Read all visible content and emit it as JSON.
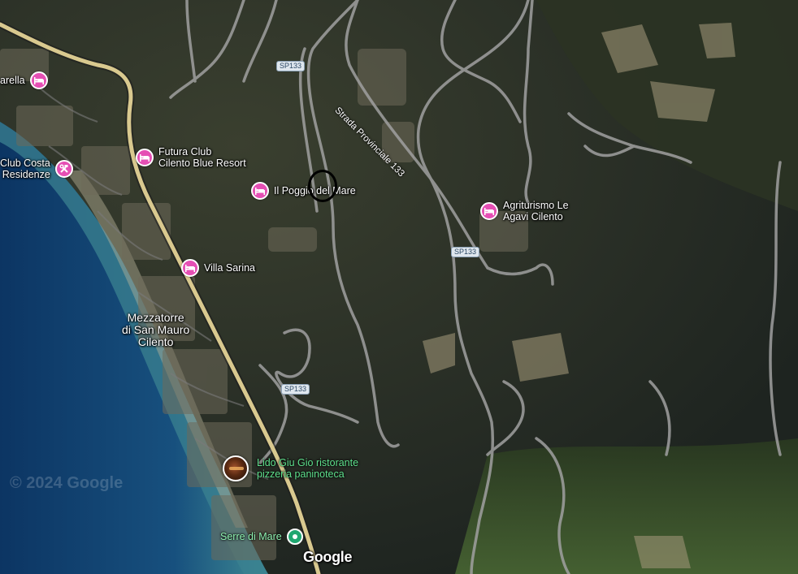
{
  "map": {
    "type": "satellite",
    "attribution": "Google",
    "copyright": "© 2024 Google"
  },
  "places": {
    "arella": {
      "name": "arella",
      "icon": "hotel-icon"
    },
    "club_costa": {
      "line1": "Club Costa",
      "line2": "Residenze",
      "icon": "tools-icon"
    },
    "futura": {
      "line1": "Futura Club",
      "line2": "Cilento Blue Resort",
      "icon": "hotel-icon"
    },
    "poggio": {
      "name": "Il Poggio del Mare",
      "icon": "hotel-icon"
    },
    "agriturismo": {
      "line1": "Agriturismo Le",
      "line2": "Agavi Cilento",
      "icon": "hotel-icon"
    },
    "villa": {
      "name": "Villa Sarina",
      "icon": "hotel-icon"
    },
    "lido": {
      "line1": "Lido Giu Gio ristorante",
      "line2": "pizzeria paninoteca",
      "icon": "restaurant-photo-icon"
    },
    "serre": {
      "name": "Serre di Mare",
      "icon": "station-icon"
    }
  },
  "town": {
    "line1": "Mezzatorre",
    "line2": "di San Mauro",
    "line3": "Cilento"
  },
  "roads": {
    "sp133_top": "SP133",
    "sp133_mid": "SP133",
    "sp133_low": "SP133",
    "strada_name": "Strada Provinciale 133"
  },
  "colors": {
    "hotel_pin": "#e54fb4",
    "station_pin": "#1fa770",
    "road_main": "#d9c98f",
    "road_minor": "#9a9a9a",
    "sea_deep": "#0e3d6e",
    "sea_shallow": "#2f7e96"
  }
}
